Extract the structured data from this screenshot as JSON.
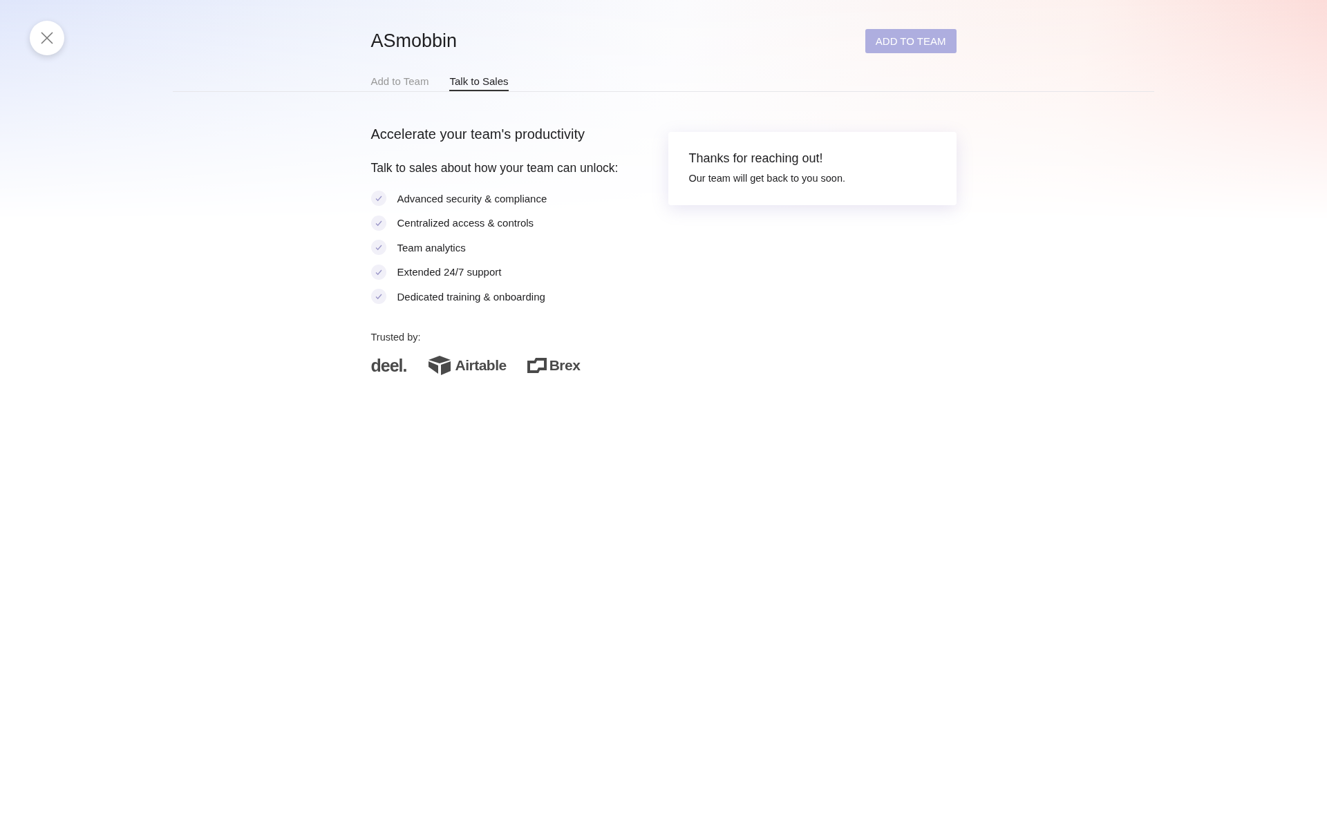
{
  "header": {
    "title": "ASmobbin",
    "action": {
      "label": "ADD TO TEAM",
      "disabled": true
    }
  },
  "tabs": [
    {
      "label": "Add to Team",
      "selected": false
    },
    {
      "label": "Talk to Sales",
      "selected": true
    }
  ],
  "pitch": {
    "heading": "Accelerate your team's productivity",
    "subheading": "Talk to sales about how your team can unlock:",
    "features": [
      "Advanced security & compliance",
      "Centralized access & controls",
      "Team analytics",
      "Extended 24/7 support",
      "Dedicated training & onboarding"
    ],
    "trusted_label": "Trusted by:",
    "logos": [
      {
        "kind": "deel",
        "name": "deel."
      },
      {
        "kind": "airtable",
        "name": "Airtable"
      },
      {
        "kind": "brex",
        "name": "Brex"
      }
    ]
  },
  "confirmation": {
    "title": "Thanks for reaching out!",
    "message": "Our team will get back to you soon."
  }
}
